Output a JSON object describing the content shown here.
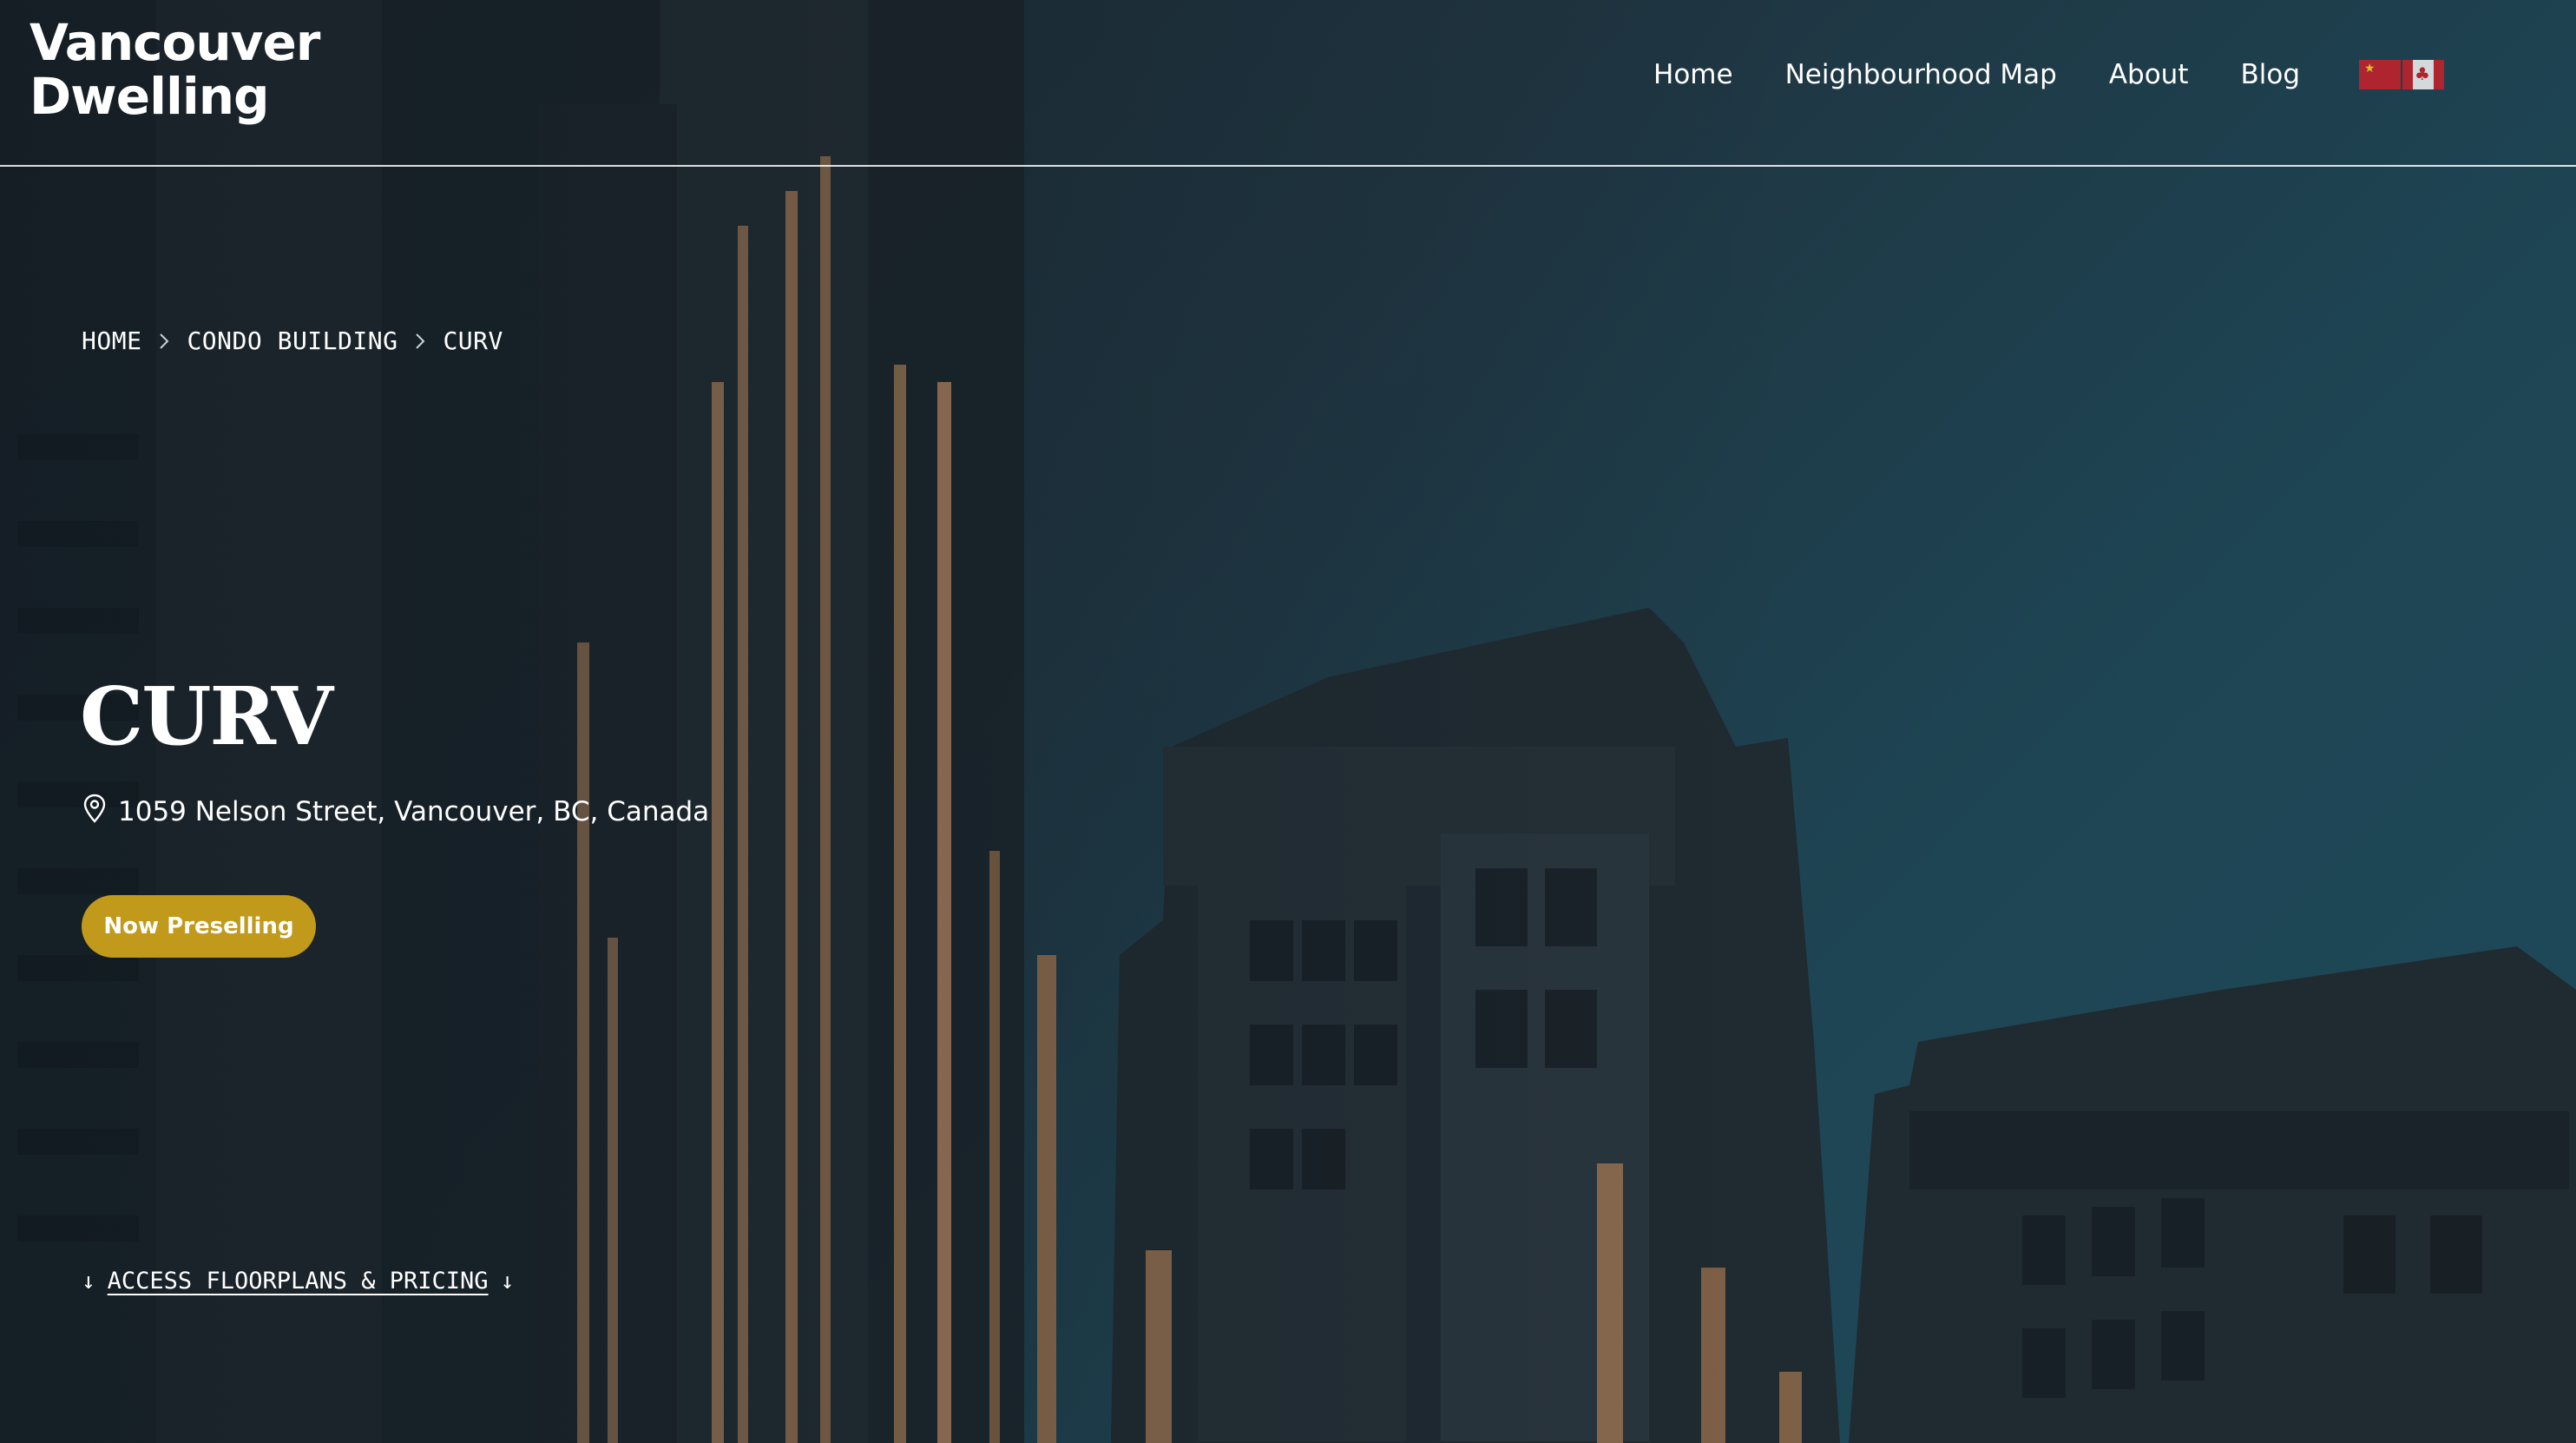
{
  "header": {
    "logo_line1": "Vancouver",
    "logo_line2": "Dwelling",
    "nav": [
      {
        "label": "Home"
      },
      {
        "label": "Neighbourhood Map"
      },
      {
        "label": "About"
      },
      {
        "label": "Blog"
      }
    ],
    "languages": [
      "china-flag-icon",
      "canada-flag-icon"
    ]
  },
  "breadcrumb": {
    "items": [
      "HOME",
      "CONDO BUILDING",
      "CURV"
    ],
    "separator_icon": "chevron-right-icon"
  },
  "hero": {
    "title": "CURV",
    "address_icon": "location-pin-icon",
    "address": "1059 Nelson Street, Vancouver, BC, Canada",
    "status_button": "Now Preselling",
    "floorplans_link": "ACCESS FLOORPLANS & PRICING",
    "arrow_glyph": "↓"
  },
  "colors": {
    "accent": "#c19a1c",
    "sky": "#1e4554",
    "text": "#ffffff"
  }
}
